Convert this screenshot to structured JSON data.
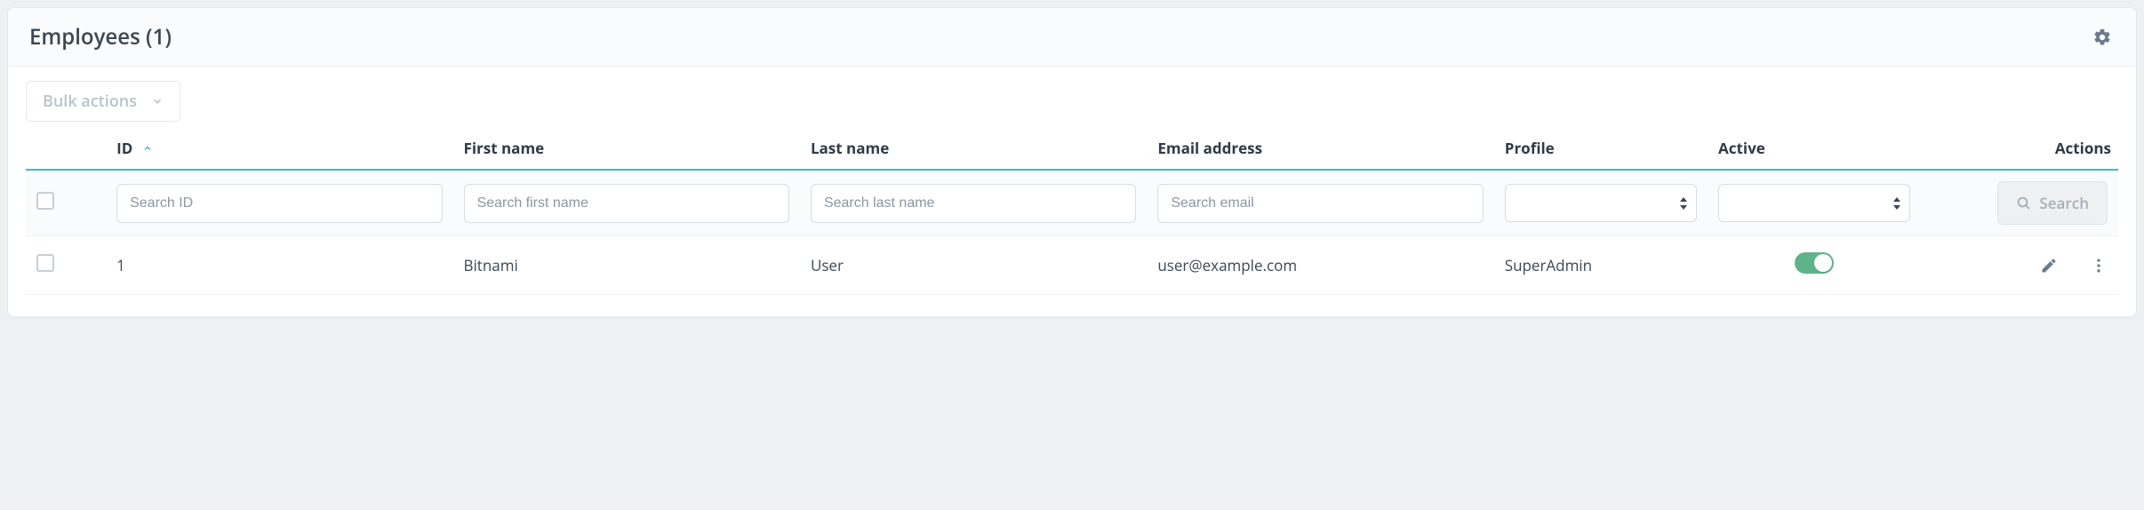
{
  "panel": {
    "title": "Employees (1)"
  },
  "toolbar": {
    "bulk_label": "Bulk actions"
  },
  "columns": {
    "id": "ID",
    "first_name": "First name",
    "last_name": "Last name",
    "email": "Email address",
    "profile": "Profile",
    "active": "Active",
    "actions": "Actions"
  },
  "filters": {
    "id_placeholder": "Search ID",
    "first_name_placeholder": "Search first name",
    "last_name_placeholder": "Search last name",
    "email_placeholder": "Search email",
    "profile_value": "",
    "active_value": "",
    "search_label": "Search"
  },
  "rows": [
    {
      "id": "1",
      "first_name": "Bitnami",
      "last_name": "User",
      "email": "user@example.com",
      "profile": "SuperAdmin",
      "active": true
    }
  ]
}
